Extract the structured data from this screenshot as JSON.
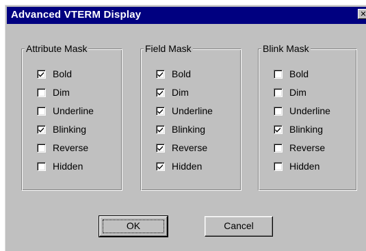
{
  "window": {
    "title": "Advanced VTERM Display",
    "close_symbol": "✕"
  },
  "groups": [
    {
      "label": "Attribute Mask",
      "items": [
        {
          "label": "Bold",
          "checked": true
        },
        {
          "label": "Dim",
          "checked": false
        },
        {
          "label": "Underline",
          "checked": false
        },
        {
          "label": "Blinking",
          "checked": true
        },
        {
          "label": "Reverse",
          "checked": false
        },
        {
          "label": "Hidden",
          "checked": false
        }
      ]
    },
    {
      "label": "Field Mask",
      "items": [
        {
          "label": "Bold",
          "checked": true
        },
        {
          "label": "Dim",
          "checked": true
        },
        {
          "label": "Underline",
          "checked": true
        },
        {
          "label": "Blinking",
          "checked": true
        },
        {
          "label": "Reverse",
          "checked": true
        },
        {
          "label": "Hidden",
          "checked": true
        }
      ]
    },
    {
      "label": "Blink Mask",
      "items": [
        {
          "label": "Bold",
          "checked": false
        },
        {
          "label": "Dim",
          "checked": false
        },
        {
          "label": "Underline",
          "checked": false
        },
        {
          "label": "Blinking",
          "checked": true
        },
        {
          "label": "Reverse",
          "checked": false
        },
        {
          "label": "Hidden",
          "checked": false
        }
      ]
    }
  ],
  "buttons": {
    "ok_label": "OK",
    "cancel_label": "Cancel"
  },
  "colors": {
    "titlebar": "#000080",
    "face": "#c0c0c0"
  }
}
